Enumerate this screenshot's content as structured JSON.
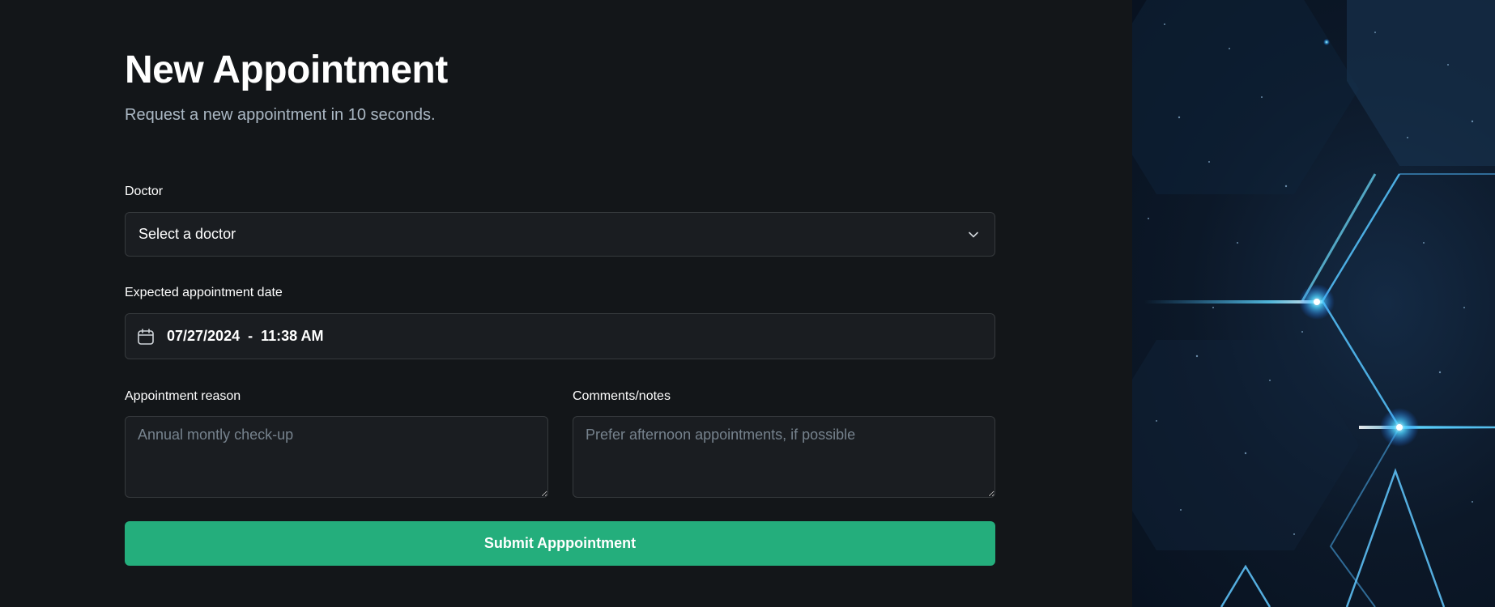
{
  "header": {
    "title": "New Appointment",
    "subtitle": "Request a new appointment in 10 seconds."
  },
  "form": {
    "doctor": {
      "label": "Doctor",
      "value": "Select a doctor"
    },
    "date": {
      "label": "Expected appointment date",
      "value": "07/27/2024  -  11:38 AM"
    },
    "reason": {
      "label": "Appointment reason",
      "placeholder": "Annual montly check-up"
    },
    "notes": {
      "label": "Comments/notes",
      "placeholder": "Prefer afternoon appointments, if possible"
    },
    "submit_label": "Submit Apppointment"
  },
  "colors": {
    "background": "#131619",
    "input_background": "#1a1d21",
    "input_border": "#363a3d",
    "accent_green": "#24ae7c",
    "label_text": "#abb8c4"
  },
  "icons": {
    "doctor_select": "chevron-down-icon",
    "date_field": "calendar-icon"
  }
}
